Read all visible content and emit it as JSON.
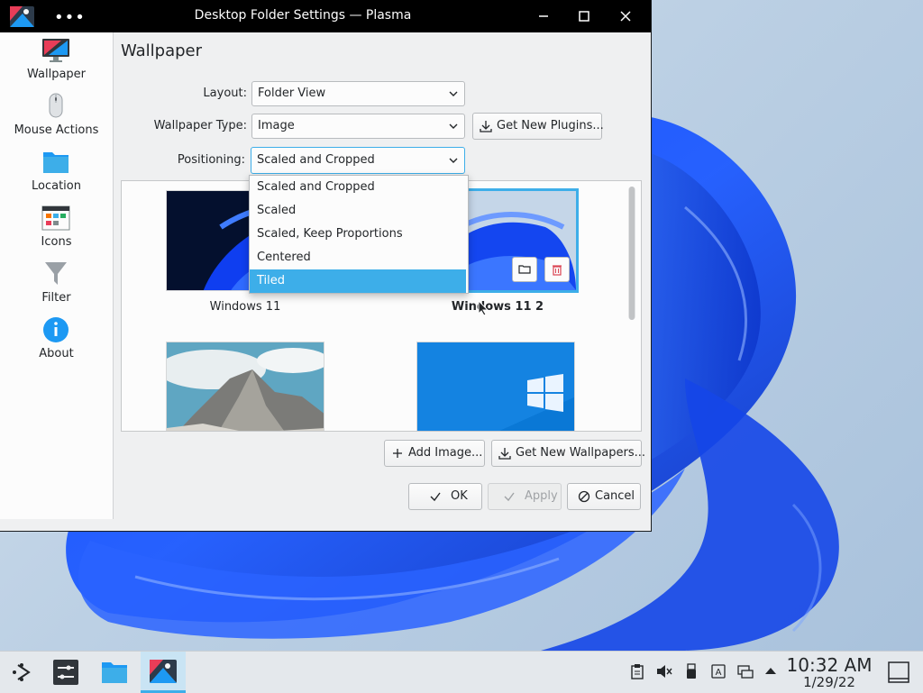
{
  "window": {
    "title": "Desktop Folder Settings — Plasma",
    "menu_glyph": "•••"
  },
  "sidebar": {
    "items": [
      {
        "label": "Wallpaper",
        "icon": "monitor-icon"
      },
      {
        "label": "Mouse Actions",
        "icon": "mouse-icon"
      },
      {
        "label": "Location",
        "icon": "folder-icon"
      },
      {
        "label": "Icons",
        "icon": "icons-grid-icon"
      },
      {
        "label": "Filter",
        "icon": "funnel-icon"
      },
      {
        "label": "About",
        "icon": "info-icon"
      }
    ]
  },
  "page": {
    "title": "Wallpaper",
    "layout_label": "Layout:",
    "layout_value": "Folder View",
    "type_label": "Wallpaper Type:",
    "type_value": "Image",
    "get_plugins": "Get New Plugins...",
    "positioning_label": "Positioning:",
    "positioning_value": "Scaled and Cropped"
  },
  "positioning_options": [
    "Scaled and Cropped",
    "Scaled",
    "Scaled, Keep Proportions",
    "Centered",
    "Tiled"
  ],
  "positioning_highlighted": "Tiled",
  "wallpapers": [
    {
      "label": "Windows 11",
      "selected": false
    },
    {
      "label": "Windows 11 2",
      "selected": true
    },
    {
      "label": "",
      "selected": false
    },
    {
      "label": "",
      "selected": false
    }
  ],
  "buttons": {
    "add_image": "Add Image...",
    "get_wallpapers": "Get New Wallpapers...",
    "ok": "OK",
    "apply": "Apply",
    "cancel": "Cancel"
  },
  "taskbar": {
    "time": "10:32 AM",
    "date": "1/29/22"
  },
  "colors": {
    "accent": "#3daee9",
    "titlebar": "#000000",
    "window_bg": "#eff0f1"
  }
}
